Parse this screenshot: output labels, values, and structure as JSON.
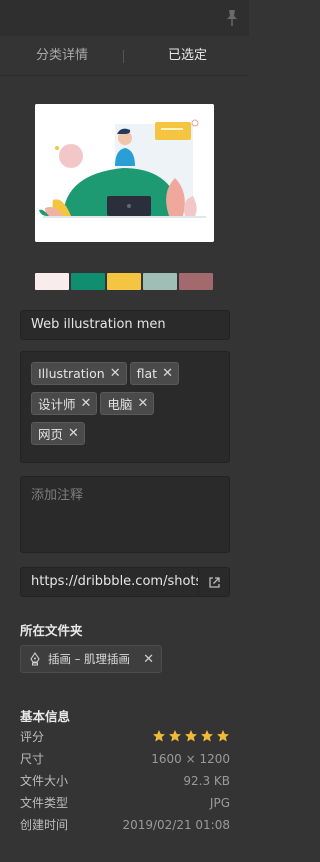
{
  "tabs": {
    "left": "分类详情",
    "right": "已选定"
  },
  "colors": {
    "palette": [
      "#f9ecec",
      "#0f8f70",
      "#f5c542",
      "#9fbfb6",
      "#a26a6c"
    ],
    "star": "#f0b93a"
  },
  "title": "Web illustration men",
  "tags": [
    {
      "label": "Illustration"
    },
    {
      "label": "flat"
    },
    {
      "label": "设计师"
    },
    {
      "label": "电脑"
    },
    {
      "label": "网页"
    }
  ],
  "note": {
    "placeholder": "添加注释"
  },
  "url": "https://dribbble.com/shots",
  "folder": {
    "heading": "所在文件夹",
    "name": "插画 – 肌理插画",
    "icon": "pen-nib-icon"
  },
  "info": {
    "heading": "基本信息",
    "rating_label": "评分",
    "rating": 5,
    "size_label": "尺寸",
    "size_value": "1600 × 1200",
    "filesize_label": "文件大小",
    "filesize_value": "92.3 KB",
    "filetype_label": "文件类型",
    "filetype_value": "JPG",
    "created_label": "创建时间",
    "created_value": "2019/02/21 01:08"
  },
  "icons": {
    "pin": "pin-icon",
    "open_link": "external-link-icon",
    "remove": "close-icon",
    "star": "star-icon"
  }
}
